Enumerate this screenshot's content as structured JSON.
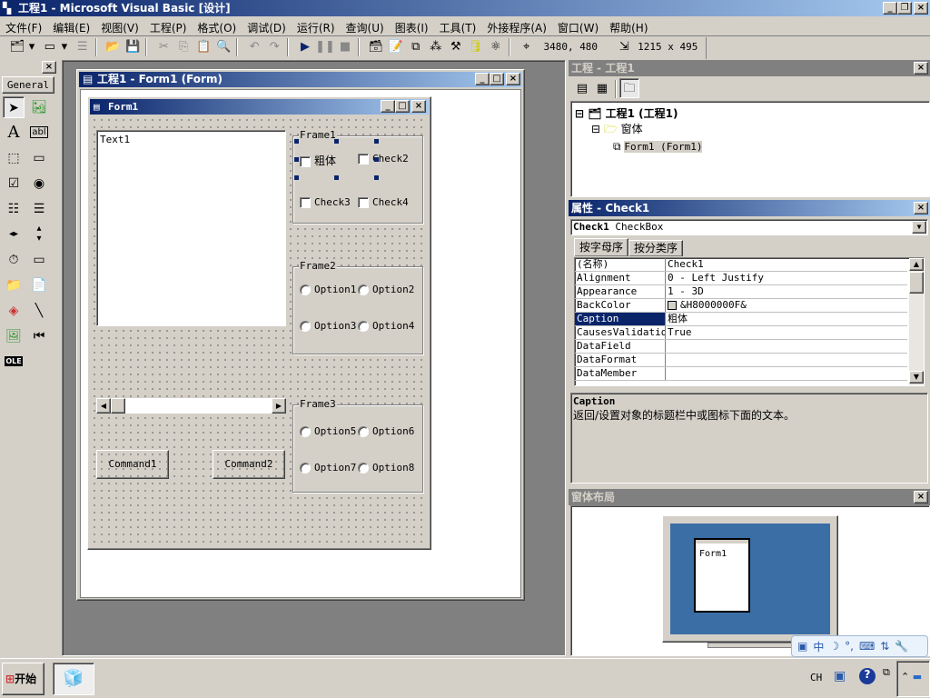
{
  "app": {
    "title": "工程1 - Microsoft Visual Basic [设计]"
  },
  "menu": [
    "文件(F)",
    "编辑(E)",
    "视图(V)",
    "工程(P)",
    "格式(O)",
    "调试(D)",
    "运行(R)",
    "查询(U)",
    "图表(I)",
    "工具(T)",
    "外接程序(A)",
    "窗口(W)",
    "帮助(H)"
  ],
  "toolbar": {
    "position": "3480, 480",
    "size": "1215 x 495"
  },
  "toolbox": {
    "tab": "General",
    "tools": [
      "pointer",
      "picturebox",
      "label",
      "textbox",
      "frame",
      "commandbutton",
      "checkbox",
      "optionbutton",
      "combobox",
      "listbox",
      "hscrollbar",
      "vscrollbar",
      "timer",
      "drivelistbox",
      "dirlistbox",
      "filelistbox",
      "shape",
      "line",
      "image",
      "data",
      "ole"
    ]
  },
  "designer": {
    "title": "工程1 - Form1 (Form)"
  },
  "form": {
    "title": "Form1",
    "text1": "Text1",
    "frame1": {
      "label": "Frame1",
      "checks": [
        "粗体",
        "Check2",
        "Check3",
        "Check4"
      ]
    },
    "frame2": {
      "label": "Frame2",
      "options": [
        "Option1",
        "Option2",
        "Option3",
        "Option4"
      ]
    },
    "frame3": {
      "label": "Frame3",
      "options": [
        "Option5",
        "Option6",
        "Option7",
        "Option8"
      ]
    },
    "command1": "Command1",
    "command2": "Command2"
  },
  "project": {
    "title": "工程 - 工程1",
    "root": "工程1 (工程1)",
    "folder": "窗体",
    "item": "Form1 (Form1)"
  },
  "properties": {
    "title": "属性 - Check1",
    "object_bold": "Check1",
    "object_type": "CheckBox",
    "tabs": [
      "按字母序",
      "按分类序"
    ],
    "rows": [
      {
        "name": "(名称)",
        "value": "Check1"
      },
      {
        "name": "Alignment",
        "value": "0 - Left Justify"
      },
      {
        "name": "Appearance",
        "value": "1 - 3D"
      },
      {
        "name": "BackColor",
        "value": "&H8000000F&"
      },
      {
        "name": "Caption",
        "value": "粗体"
      },
      {
        "name": "CausesValidation",
        "value": "True"
      },
      {
        "name": "DataField",
        "value": ""
      },
      {
        "name": "DataFormat",
        "value": ""
      },
      {
        "name": "DataMember",
        "value": ""
      }
    ],
    "selected": "Caption",
    "desc_title": "Caption",
    "desc_text": "返回/设置对象的标题栏中或图标下面的文本。"
  },
  "layout": {
    "title": "窗体布局",
    "form_label": "Form1"
  },
  "ime": [
    "中",
    "☽",
    "°,",
    "⌨",
    "⇅",
    "🔧"
  ],
  "taskbar": {
    "start": "开始",
    "lang": "CH"
  },
  "colors": {
    "title_active": "#0a246a",
    "face": "#d4d0c8",
    "mdi": "#808080",
    "desktop": "#3a6ea5"
  }
}
